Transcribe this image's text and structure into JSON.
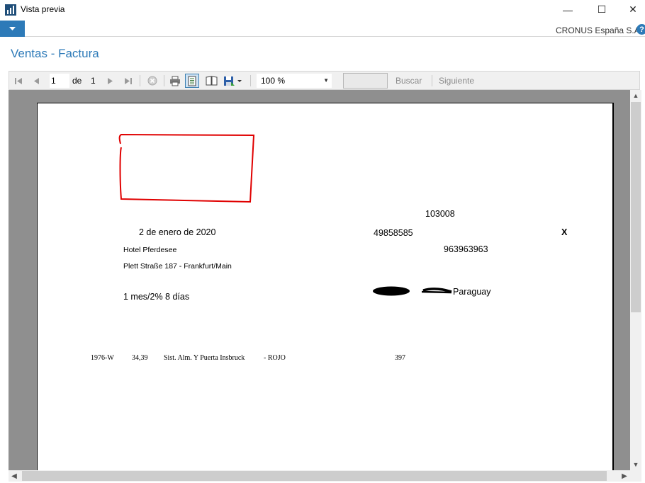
{
  "window": {
    "title": "Vista previa",
    "minimize": "—",
    "maximize": "☐",
    "close": "✕"
  },
  "header": {
    "company": "CRONUS España S.A.",
    "help": "?"
  },
  "page_title": "Ventas - Factura",
  "toolbar": {
    "current_page": "1",
    "of_label": "de",
    "total_pages": "1",
    "zoom": "100 %",
    "search_value": "",
    "find_label": "Buscar",
    "next_label": "Siguiente"
  },
  "report": {
    "number": "103008",
    "date": "2 de enero de 2020",
    "doc_ref": "49858585",
    "mark": "X",
    "customer_name": "Hotel Pferdesee",
    "phone": "963963963",
    "address": "Plett Straße 187 - Frankfurt/Main",
    "payment_terms": "1 mes/2% 8 días",
    "country": "Paraguay",
    "line": {
      "item": "1976-W",
      "price": "34,39",
      "description": "Sist. Alm. Y Puerta Insbruck",
      "variant": "- ROJO",
      "amount": "397"
    }
  },
  "colors": {
    "accent": "#2d7ab8",
    "annotation_red": "#e00000"
  }
}
